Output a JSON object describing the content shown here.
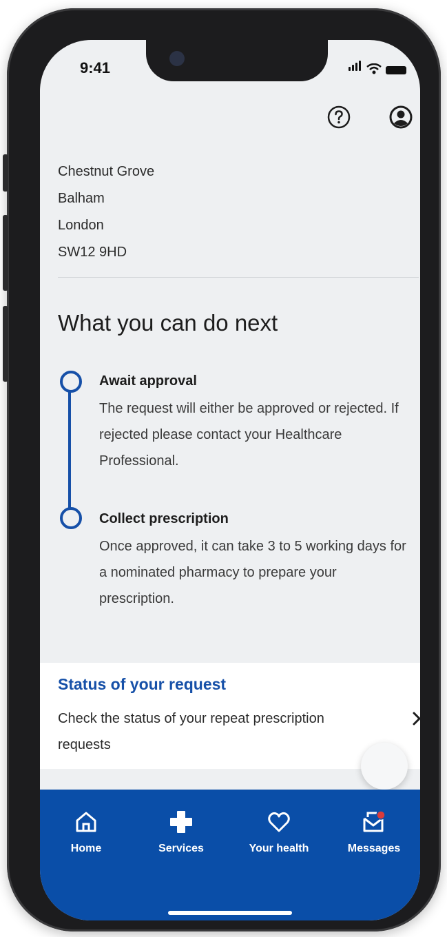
{
  "status_bar": {
    "time": "9:41"
  },
  "header": {
    "help_icon": "question-circle-icon",
    "profile_icon": "user-circle-icon"
  },
  "address": {
    "line1": "Chestnut Grove",
    "line2": "Balham",
    "line3": "London",
    "line4": "SW12 9HD"
  },
  "next_steps": {
    "heading": "What you can do next",
    "steps": [
      {
        "title": "Await approval",
        "text": "The request will either be approved or rejected. If rejected please contact your Healthcare Professional."
      },
      {
        "title": "Collect prescription",
        "text": "Once approved, it can take 3 to 5 working days for a nominated pharmacy to prepare your prescription."
      }
    ]
  },
  "status_card": {
    "title": "Status of your request",
    "description": "Check the status of your repeat prescription requests"
  },
  "nav": {
    "items": [
      {
        "label": "Home",
        "icon": "home-icon"
      },
      {
        "label": "Services",
        "icon": "plus-icon"
      },
      {
        "label": "Your health",
        "icon": "heart-icon"
      },
      {
        "label": "Messages",
        "icon": "envelope-icon"
      }
    ]
  },
  "colors": {
    "accent": "#1650a8",
    "nav_bg": "#0a4ea8",
    "background": "#eef0f2",
    "notification": "#d93b3b"
  }
}
